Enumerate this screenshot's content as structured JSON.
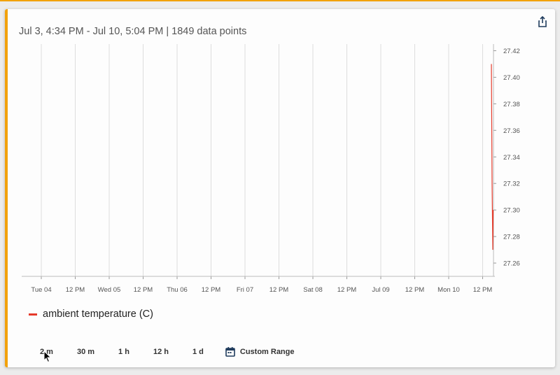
{
  "header": {
    "title": "Jul 3, 4:34 PM - Jul 10, 5:04 PM | 1849 data points"
  },
  "icons": {
    "share": "share-icon",
    "calendar": "calendar-icon"
  },
  "legend": {
    "label": "ambient temperature  (C)"
  },
  "time_ranges": [
    "2 m",
    "30 m",
    "1 h",
    "12 h",
    "1 d"
  ],
  "custom_range_label": "Custom Range",
  "colors": {
    "accent": "#f2a20c",
    "series": "#e53a2a",
    "icon": "#1f3b5c"
  },
  "chart_data": {
    "type": "line",
    "x_tick_labels": [
      "Tue 04",
      "12 PM",
      "Wed 05",
      "12 PM",
      "Thu 06",
      "12 PM",
      "Fri 07",
      "12 PM",
      "Sat 08",
      "12 PM",
      "Jul 09",
      "12 PM",
      "Mon 10",
      "12 PM"
    ],
    "y_ticks": [
      27.26,
      27.28,
      27.3,
      27.32,
      27.34,
      27.36,
      27.38,
      27.4,
      27.42
    ],
    "ylim": [
      27.25,
      27.425
    ],
    "grid": "vertical",
    "y_axis_position": "right",
    "series": [
      {
        "name": "ambient temperature  (C)",
        "x": [
          "2023-07-10T16:34",
          "2023-07-10T16:44",
          "2023-07-10T16:54",
          "2023-07-10T17:04"
        ],
        "values": [
          27.41,
          27.32,
          27.27,
          27.3
        ]
      }
    ]
  }
}
